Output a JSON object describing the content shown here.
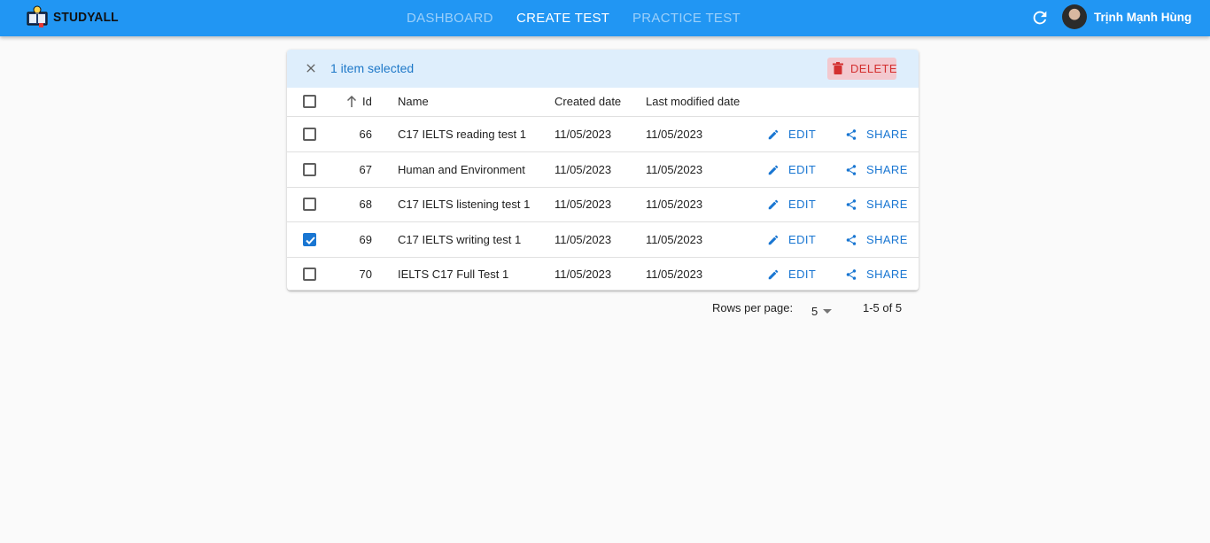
{
  "app": {
    "name": "STUDYALL"
  },
  "nav": {
    "items": [
      "DASHBOARD",
      "CREATE TEST",
      "PRACTICE TEST"
    ],
    "active": 1
  },
  "user": {
    "name": "Trịnh Mạnh Hùng"
  },
  "selection": {
    "text": "1 item selected",
    "delete_label": "DELETE"
  },
  "table": {
    "columns": [
      "Id",
      "Name",
      "Created date",
      "Last modified date"
    ],
    "sort_icon": "arrow-up-icon",
    "edit_label": "EDIT",
    "share_label": "SHARE",
    "rows": [
      {
        "id": "66",
        "name": "C17 IELTS reading test 1",
        "created": "11/05/2023",
        "modified": "11/05/2023",
        "checked": false
      },
      {
        "id": "67",
        "name": "Human and Environment",
        "created": "11/05/2023",
        "modified": "11/05/2023",
        "checked": false
      },
      {
        "id": "68",
        "name": "C17 IELTS listening test 1",
        "created": "11/05/2023",
        "modified": "11/05/2023",
        "checked": false
      },
      {
        "id": "69",
        "name": "C17 IELTS writing test 1",
        "created": "11/05/2023",
        "modified": "11/05/2023",
        "checked": true
      },
      {
        "id": "70",
        "name": "IELTS C17 Full Test 1",
        "created": "11/05/2023",
        "modified": "11/05/2023",
        "checked": false
      }
    ]
  },
  "pagination": {
    "rows_label": "Rows per page:",
    "rows_value": "5",
    "range": "1-5 of 5"
  },
  "colors": {
    "appbar": "#2196f3",
    "accent": "#1976d2",
    "danger": "#d32f2f",
    "toolbar": "#deeefc"
  }
}
